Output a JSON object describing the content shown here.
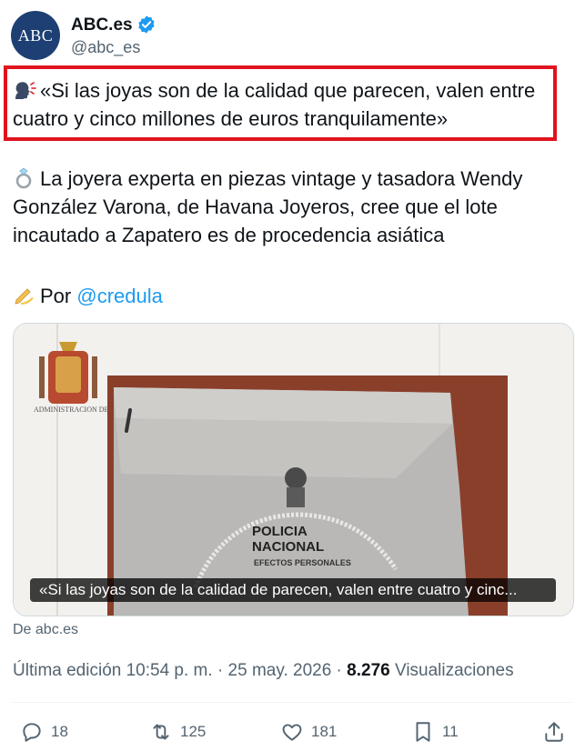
{
  "author": {
    "avatar_text": "ABC",
    "name": "ABC.es",
    "handle": "@abc_es"
  },
  "tweet": {
    "quote": "«Si las joyas son de la calidad que parecen, valen entre cuatro y cinco millones de euros tranquilamente»",
    "body": "La joyera experta en piezas vintage y tasadora Wendy González Varona, de Havana Joyeros, cree que el lote incautado a Zapatero es de procedencia asiática",
    "byline_prefix": "Por",
    "byline_mention": "@credula"
  },
  "card": {
    "caption": "«Si las joyas son de la calidad de parecen, valen entre cuatro y cinc...",
    "doc_header": "ADMINISTRACION DE JUSTICIA",
    "bag_label_1": "POLICIA",
    "bag_label_2": "NACIONAL",
    "bag_label_3": "EFECTOS PERSONALES",
    "source": "De abc.es"
  },
  "meta": {
    "edited": "Última edición 10:54 p. m. · 25 may. 2026 ·",
    "views_count": "8.276",
    "views_label": "Visualizaciones"
  },
  "actions": {
    "replies": "18",
    "reposts": "125",
    "likes": "181",
    "bookmarks": "11"
  },
  "colors": {
    "accent": "#1d9bf0",
    "highlight": "#e0141e",
    "muted": "#536471"
  }
}
